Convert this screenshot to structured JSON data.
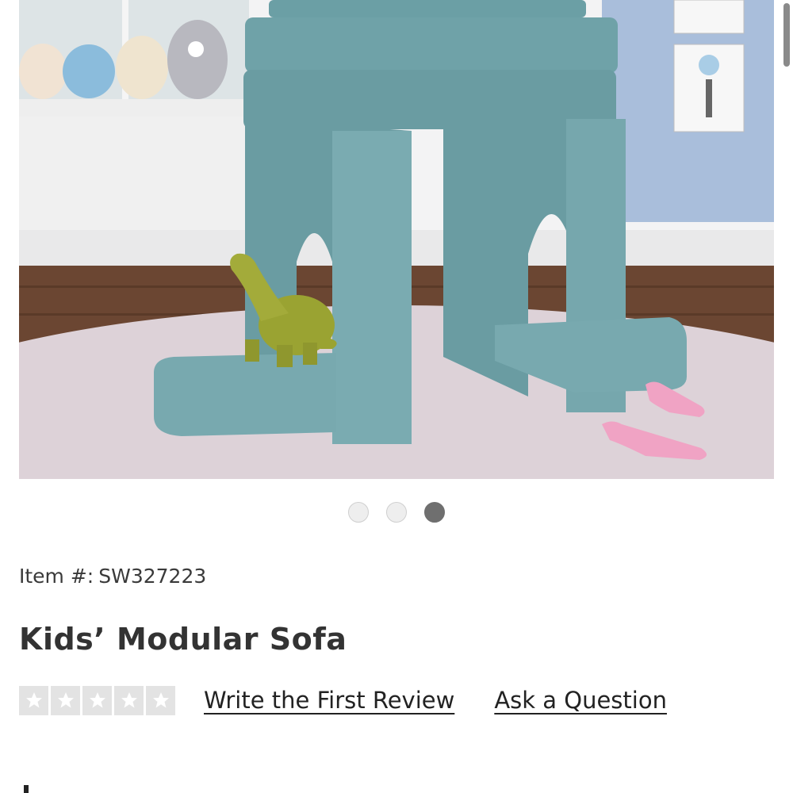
{
  "gallery": {
    "dots": [
      {
        "state": "inactive"
      },
      {
        "state": "inactive"
      },
      {
        "state": "active"
      }
    ]
  },
  "product": {
    "item_label": "Item #:",
    "item_number": "SW327223",
    "title": "Kids’ Modular Sofa"
  },
  "rating": {
    "stars_filled": 0,
    "stars_total": 5,
    "write_review_label": "Write the First Review",
    "ask_question_label": "Ask a Question"
  },
  "colors": {
    "sofa_teal": "#6fa2a8",
    "wall_blue": "#a9bedb",
    "rug_pink": "#ddd2d8",
    "floor_wood": "#6b4632",
    "dinosaur_green": "#9aa332",
    "shoe_pink": "#f0a3c4"
  }
}
